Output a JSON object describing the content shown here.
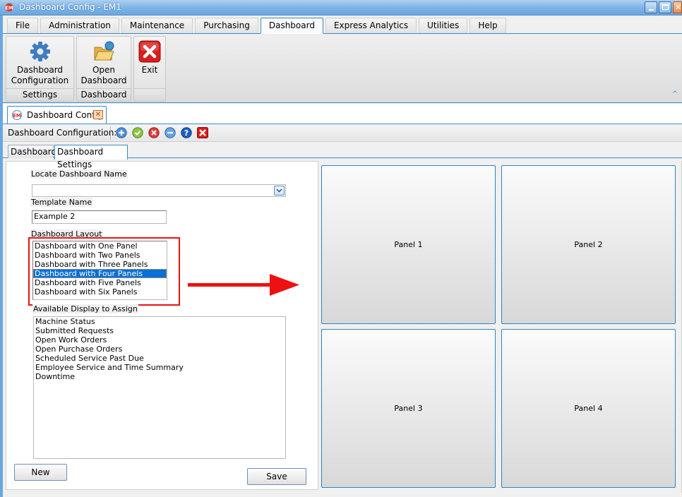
{
  "window": {
    "title": "Dashboard Config - EM1",
    "controls": [
      "minimize",
      "maximize",
      "close"
    ]
  },
  "menu_tabs": [
    {
      "label": "File",
      "active": false
    },
    {
      "label": "Administration",
      "active": false
    },
    {
      "label": "Maintenance",
      "active": false
    },
    {
      "label": "Purchasing",
      "active": false
    },
    {
      "label": "Dashboard",
      "active": true
    },
    {
      "label": "Express Analytics",
      "active": false
    },
    {
      "label": "Utilities",
      "active": false
    },
    {
      "label": "Help",
      "active": false
    }
  ],
  "ribbon": {
    "groups": [
      {
        "button_label_1": "Dashboard",
        "button_label_2": "Configuration",
        "group_label": "Settings",
        "icon": "gear-icon"
      },
      {
        "button_label_1": "Open",
        "button_label_2": "Dashboard",
        "group_label": "Dashboard",
        "icon": "open-folder-icon"
      },
      {
        "button_label_1": "Exit",
        "button_label_2": "",
        "group_label": "",
        "icon": "exit-icon"
      }
    ]
  },
  "document_tab": {
    "label": "Dashboard Config"
  },
  "toolbar": {
    "label": "Dashboard Configuration:",
    "icons": [
      "add-icon",
      "accept-icon",
      "cancel-icon",
      "remove-icon",
      "help-icon",
      "close-icon"
    ]
  },
  "settings_tabs": [
    {
      "label": "Dashboards",
      "active": false
    },
    {
      "label": "Dashboard Settings",
      "active": true
    }
  ],
  "form": {
    "locate_label": "Locate Dashboard Name",
    "locate_value": "",
    "template_label": "Template Name",
    "template_value": "Example 2",
    "layout_label": "Dashboard Layout",
    "layout_options": [
      "Dashboard with One Panel",
      "Dashboard with Two Panels",
      "Dashboard with Three Panels",
      "Dashboard with Four Panels",
      "Dashboard with Five Panels",
      "Dashboard with Six Panels"
    ],
    "layout_selected": "Dashboard with Four Panels",
    "available_label": "Available Display to Assign",
    "available_items": [
      "Machine Status",
      "Submitted Requests",
      "Open Work Orders",
      "Open Purchase Orders",
      "Scheduled Service Past Due",
      "Employee Service and Time Summary",
      "Downtime"
    ],
    "new_label": "New",
    "save_label": "Save"
  },
  "panels": [
    "Panel 1",
    "Panel 2",
    "Panel 3",
    "Panel 4"
  ],
  "annotation": {
    "color": "#ee1111"
  }
}
